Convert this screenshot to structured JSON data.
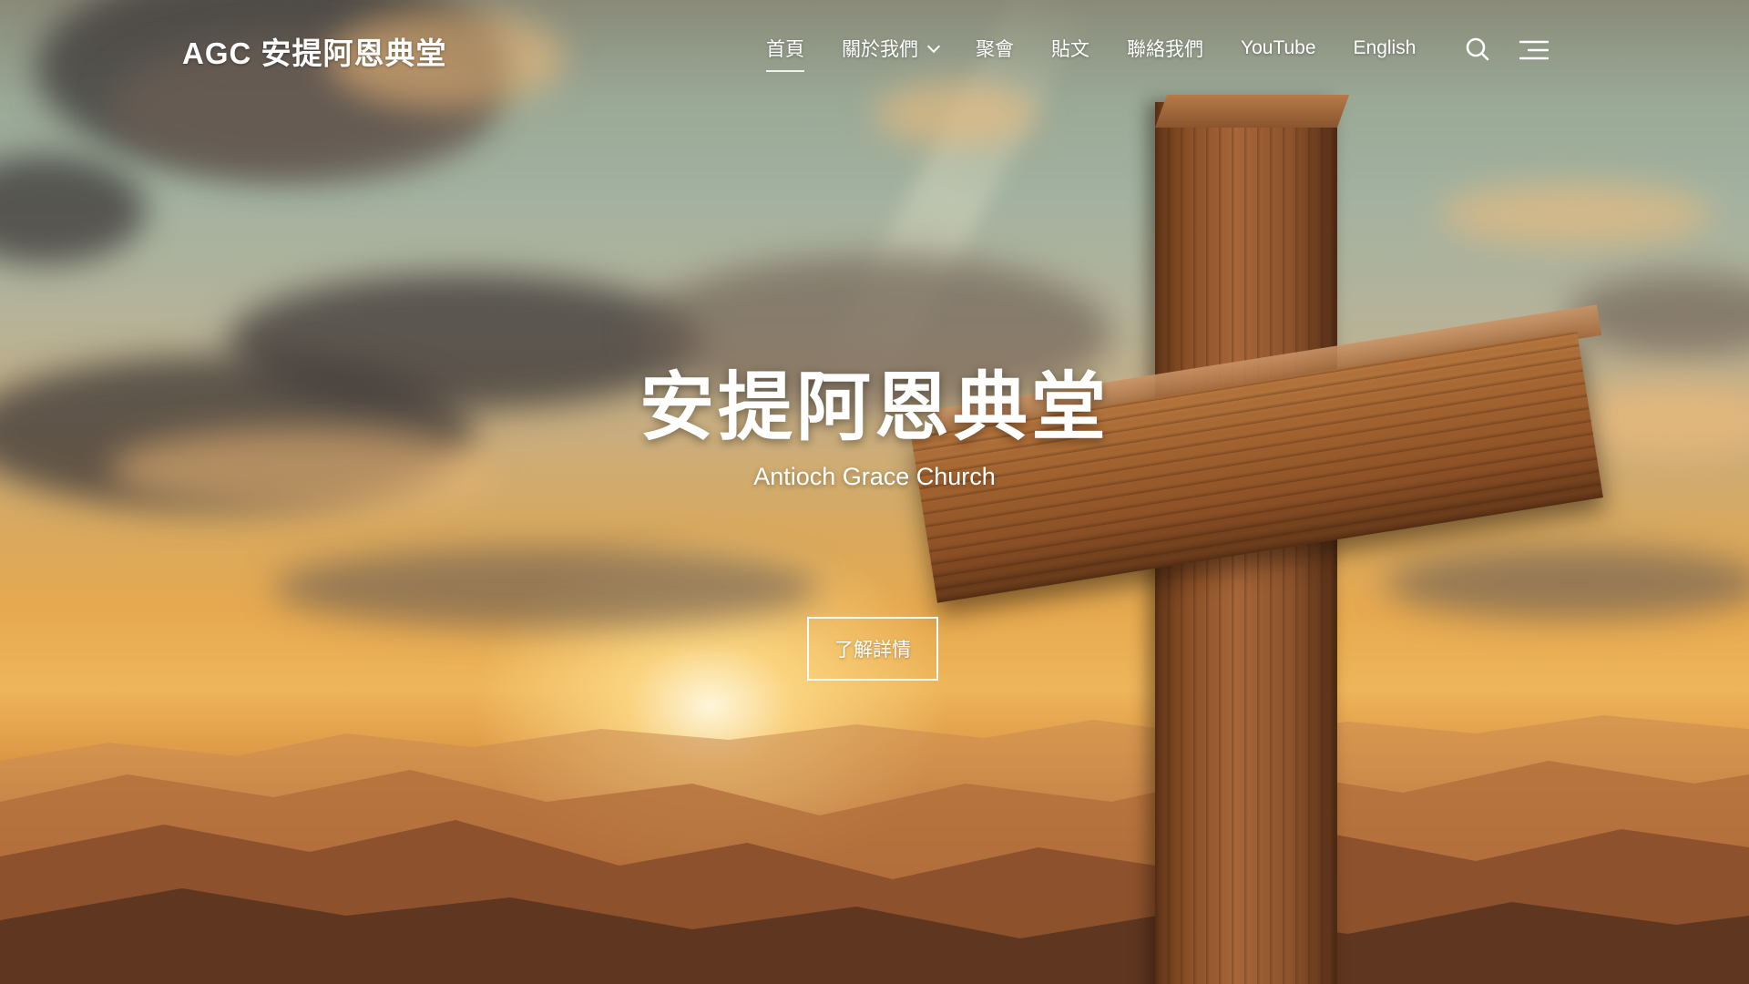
{
  "header": {
    "logo": "AGC 安提阿恩典堂",
    "nav": [
      {
        "label": "首頁",
        "active": true,
        "has_dropdown": false
      },
      {
        "label": "關於我們",
        "active": false,
        "has_dropdown": true
      },
      {
        "label": "聚會",
        "active": false,
        "has_dropdown": false
      },
      {
        "label": "貼文",
        "active": false,
        "has_dropdown": false
      },
      {
        "label": "聯絡我們",
        "active": false,
        "has_dropdown": false
      },
      {
        "label": "YouTube",
        "active": false,
        "has_dropdown": false
      },
      {
        "label": "English",
        "active": false,
        "has_dropdown": false
      }
    ],
    "icons": {
      "search": "search-icon",
      "menu": "menu-icon",
      "dropdown": "chevron-down-icon"
    }
  },
  "hero": {
    "title": "安提阿恩典堂",
    "subtitle": "Antioch Grace Church",
    "button_label": "了解詳情",
    "background": "sunset sky with mountains and wooden cross"
  },
  "colors": {
    "text": "#ffffff",
    "sky_top": "#9aa896",
    "sun_glow": "#eeb55a",
    "cross_wood": "#a1622f"
  }
}
